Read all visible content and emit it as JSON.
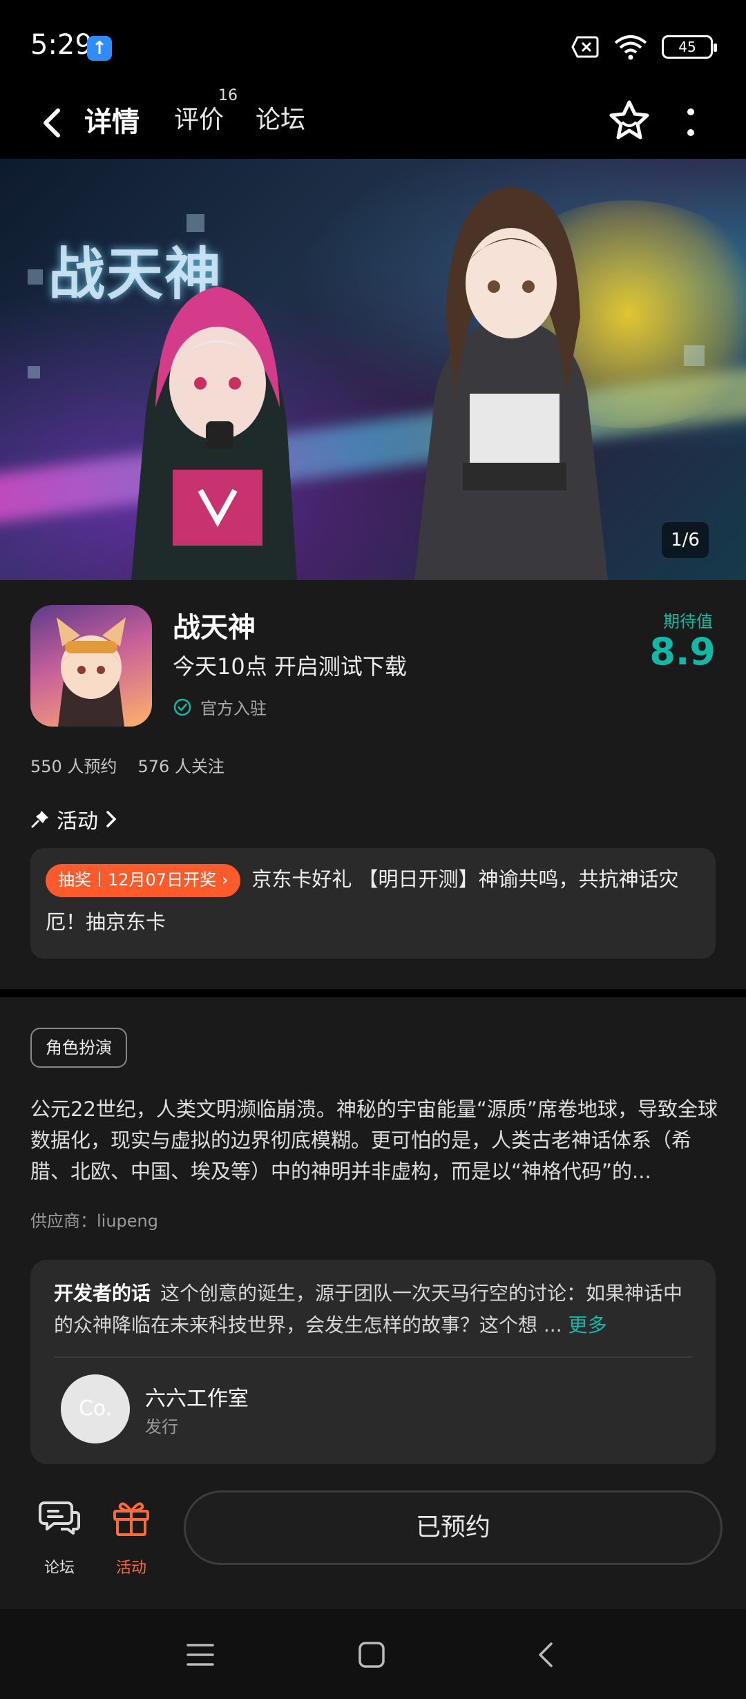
{
  "status_bar": {
    "time": "5:29",
    "upload_badge": "↑",
    "battery": "45"
  },
  "nav": {
    "tabs": [
      {
        "label": "详情",
        "active": true
      },
      {
        "label": "评价",
        "badge": "16"
      },
      {
        "label": "论坛"
      }
    ]
  },
  "banner": {
    "title_art": "战天神",
    "page_indicator": "1/6"
  },
  "game": {
    "name": "战天神",
    "subtitle": "今天10点 开启测试下载",
    "official_label": "官方入驻",
    "expect_label": "期待值",
    "expect_value": "8.9",
    "reservations": "550 人预约",
    "followers": "576 人关注"
  },
  "activity": {
    "header": "活动",
    "tag": "抽奖丨12月07日开奖 ›",
    "text": "京东卡好礼 【明日开测】神谕共鸣，共抗神话灾厄！抽京东卡"
  },
  "details": {
    "genre_tag": "角色扮演",
    "description": "公元22世纪，人类文明濒临崩溃。神秘的宇宙能量“源质”席卷地球，导致全球数据化，现实与虚拟的边界彻底模糊。更可怕的是，人类古老神话体系（希腊、北欧、中国、埃及等）中的神明并非虚构，而是以“神格代码”的...",
    "supplier": "供应商：liupeng"
  },
  "developer": {
    "heading": "开发者的话",
    "text": "这个创意的诞生，源于团队一次天马行空的讨论：如果神话中的众神降临在未来科技世界，会发生怎样的故事？这个想 ...",
    "more": "更多",
    "avatar_text": "Co.",
    "studio_name": "六六工作室",
    "studio_role": "发行"
  },
  "action_bar": {
    "forum_label": "论坛",
    "activity_label": "活动",
    "reserve_button": "已预约"
  },
  "colors": {
    "accent": "#14b8a6",
    "tag": "#ff5a2c",
    "activity_icon": "#ff6a3c"
  }
}
